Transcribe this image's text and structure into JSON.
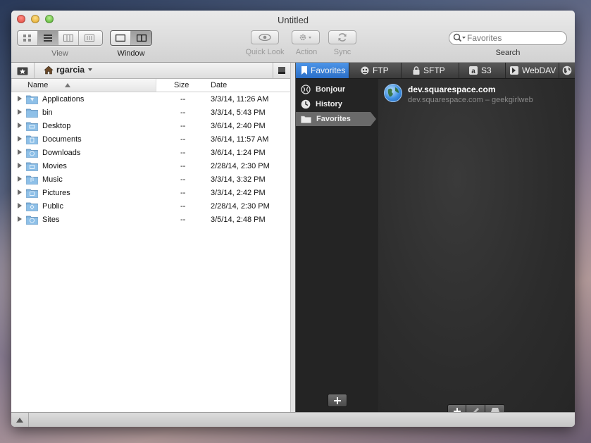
{
  "window": {
    "title": "Untitled"
  },
  "toolbar": {
    "view_label": "View",
    "window_label": "Window",
    "quicklook_label": "Quick Look",
    "action_label": "Action",
    "sync_label": "Sync",
    "search_label": "Search",
    "search_placeholder": "Favorites"
  },
  "browser": {
    "path": "rgarcia",
    "columns": {
      "name": "Name",
      "size": "Size",
      "date": "Date"
    },
    "rows": [
      {
        "name": "Applications",
        "size": "--",
        "date": "3/3/14, 11:26 AM",
        "icon": "applications-folder-icon"
      },
      {
        "name": "bin",
        "size": "--",
        "date": "3/3/14, 5:43 PM",
        "icon": "folder-icon"
      },
      {
        "name": "Desktop",
        "size": "--",
        "date": "3/6/14, 2:40 PM",
        "icon": "desktop-folder-icon"
      },
      {
        "name": "Documents",
        "size": "--",
        "date": "3/6/14, 11:57 AM",
        "icon": "documents-folder-icon"
      },
      {
        "name": "Downloads",
        "size": "--",
        "date": "3/6/14, 1:24 PM",
        "icon": "downloads-folder-icon"
      },
      {
        "name": "Movies",
        "size": "--",
        "date": "2/28/14, 2:30 PM",
        "icon": "movies-folder-icon"
      },
      {
        "name": "Music",
        "size": "--",
        "date": "3/3/14, 3:32 PM",
        "icon": "music-folder-icon"
      },
      {
        "name": "Pictures",
        "size": "--",
        "date": "3/3/14, 2:42 PM",
        "icon": "pictures-folder-icon"
      },
      {
        "name": "Public",
        "size": "--",
        "date": "2/28/14, 2:30 PM",
        "icon": "public-folder-icon"
      },
      {
        "name": "Sites",
        "size": "--",
        "date": "3/5/14, 2:48 PM",
        "icon": "sites-folder-icon"
      }
    ]
  },
  "connect": {
    "tabs": [
      {
        "label": "Favorites",
        "active": true
      },
      {
        "label": "FTP"
      },
      {
        "label": "SFTP"
      },
      {
        "label": "S3"
      },
      {
        "label": "WebDAV"
      }
    ],
    "sidebar": [
      {
        "label": "Bonjour",
        "icon": "bonjour-icon"
      },
      {
        "label": "History",
        "icon": "clock-icon"
      },
      {
        "label": "Favorites",
        "icon": "folder-icon",
        "selected": true
      }
    ],
    "favorites": [
      {
        "title": "dev.squarespace.com",
        "subtitle": "dev.squarespace.com – geekgirlweb"
      }
    ]
  },
  "colors": {
    "accent_blue": "#2a6ec7",
    "dark_panel": "#2c2c2c"
  }
}
